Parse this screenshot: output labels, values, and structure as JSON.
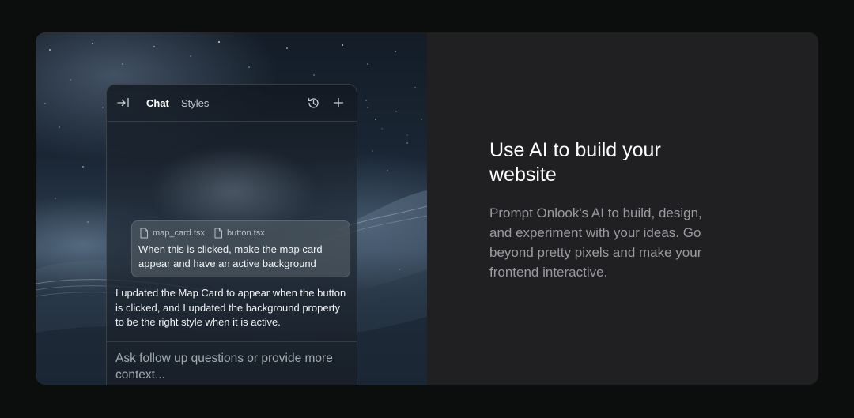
{
  "feature": {
    "headline": "Use AI to build your website",
    "description": "Prompt Onlook's AI to build, design, and experiment with your ideas. Go beyond pretty pixels and make your frontend interactive."
  },
  "chat_panel": {
    "tabs": [
      {
        "label": "Chat",
        "active": true
      },
      {
        "label": "Styles",
        "active": false
      }
    ],
    "icons": [
      "collapse-panel-icon",
      "history-icon",
      "plus-icon",
      "file-icon"
    ],
    "user_message": {
      "attachments": [
        "map_card.tsx",
        "button.tsx"
      ],
      "text": "When this is clicked, make the map card appear and have an active background"
    },
    "assistant_message": "I updated the Map Card to appear when the button is clicked, and I updated the background property to be the right style when it is active.",
    "input_placeholder": "Ask follow up questions or provide more context..."
  },
  "colors": {
    "page_background": "#0c0d0d",
    "card_background": "#202023",
    "headline": "#ffffff",
    "description": "#9a9aa0"
  }
}
